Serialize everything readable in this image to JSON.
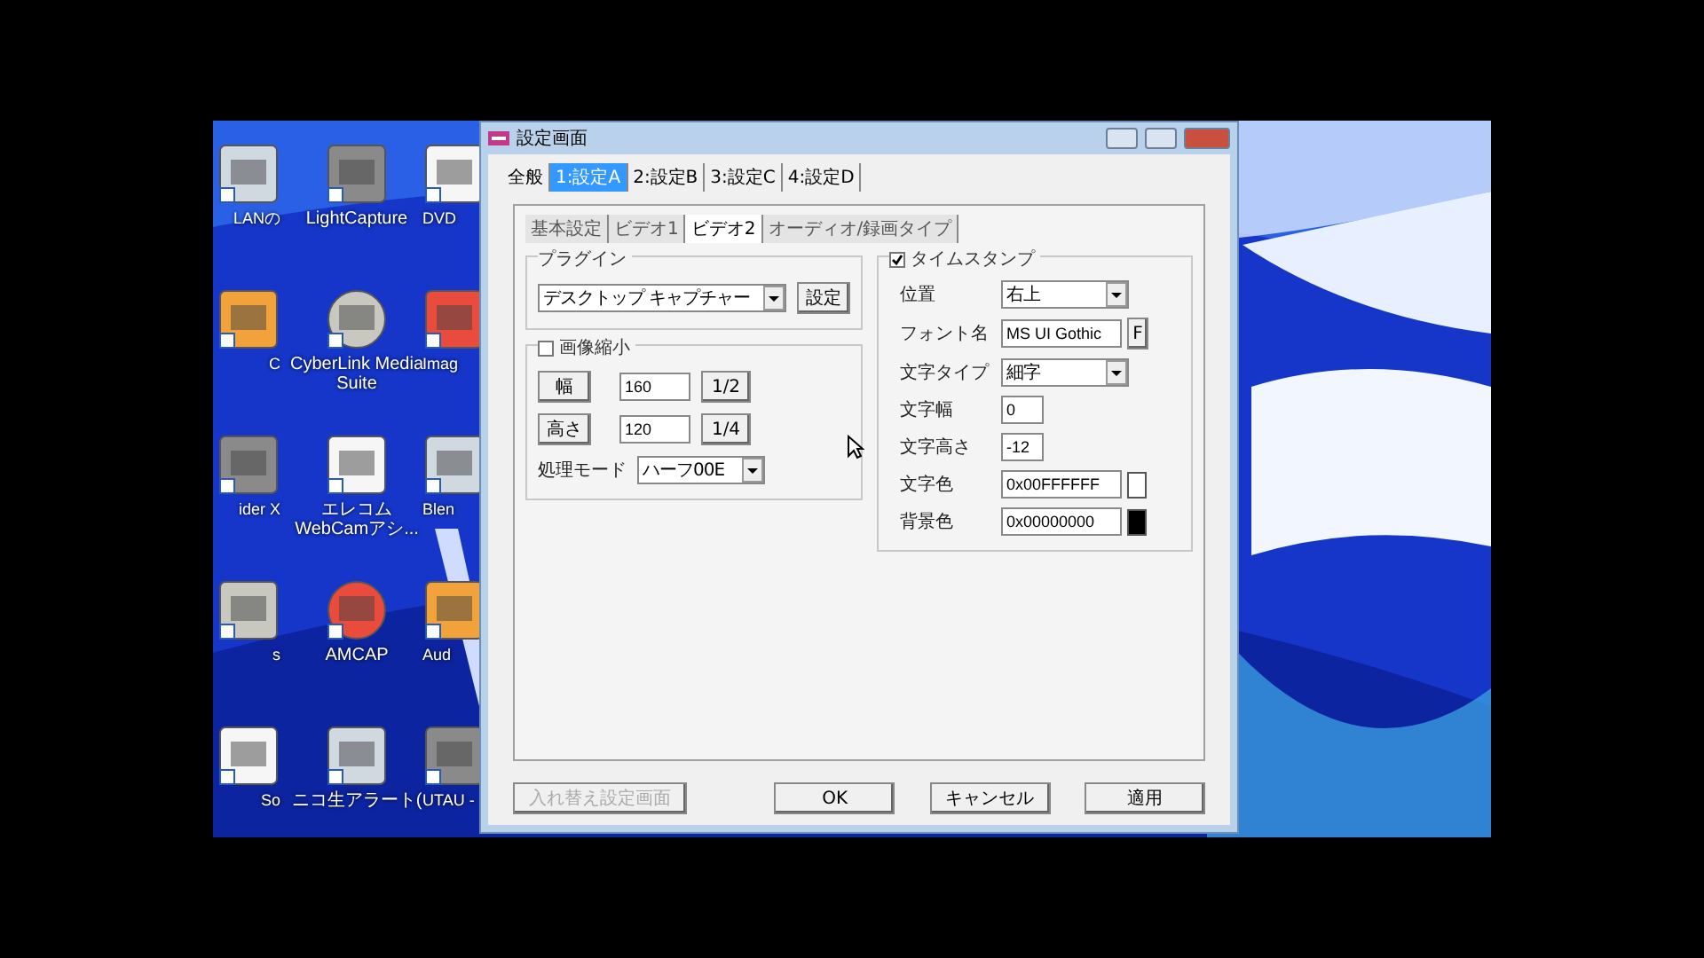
{
  "desktop": {
    "columns": [
      {
        "icons": [
          {
            "label": "LANの"
          },
          {
            "label": "C"
          },
          {
            "label": "ider X"
          },
          {
            "label": "s"
          },
          {
            "label": "So"
          }
        ]
      },
      {
        "icons": [
          {
            "label": "LightCapture"
          },
          {
            "label": "CyberLink Media Suite"
          },
          {
            "label": "エレコム WebCamアシ..."
          },
          {
            "label": "AMCAP"
          },
          {
            "label": "ニコ生アラート("
          }
        ]
      },
      {
        "icons": [
          {
            "label": "DVD"
          },
          {
            "label": "Imag"
          },
          {
            "label": "Blen"
          },
          {
            "label": "Aud"
          },
          {
            "label": "UTAU - "
          }
        ]
      }
    ]
  },
  "dialog": {
    "title": "設定画面",
    "tabs": [
      {
        "label": "全般",
        "selected": false
      },
      {
        "label": "1:設定A",
        "selected": true
      },
      {
        "label": "2:設定B",
        "selected": false
      },
      {
        "label": "3:設定C",
        "selected": false
      },
      {
        "label": "4:設定D",
        "selected": false
      }
    ],
    "subtabs": [
      {
        "label": "基本設定",
        "selected": false
      },
      {
        "label": "ビデオ1",
        "selected": false
      },
      {
        "label": "ビデオ2",
        "selected": true
      },
      {
        "label": "オーディオ/録画タイプ",
        "selected": false
      }
    ],
    "plugin_group": {
      "title": "プラグイン",
      "plugin": "デスクトップ キャプチャー",
      "button": "設定"
    },
    "resize_group": {
      "title": "画像縮小",
      "checked": false,
      "rows": [
        {
          "button": "幅",
          "value": "160",
          "ratio": "1/2"
        },
        {
          "button": "高さ",
          "value": "120",
          "ratio": "1/4"
        }
      ],
      "mode_label": "処理モード",
      "mode": "ハーフ00E"
    },
    "timestamp_group": {
      "title": "タイムスタンプ",
      "checked": true,
      "rows": [
        {
          "kind": "select",
          "label": "位置",
          "value": "右上"
        },
        {
          "kind": "font",
          "label": "フォント名",
          "value": "MS UI Gothic",
          "button": "F"
        },
        {
          "kind": "select",
          "label": "文字タイプ",
          "value": "細字"
        },
        {
          "kind": "text",
          "label": "文字幅",
          "value": "0"
        },
        {
          "kind": "text",
          "label": "文字高さ",
          "value": "-12"
        },
        {
          "kind": "color",
          "label": "文字色",
          "value": "0x00FFFFFF",
          "color": "#ffffff"
        },
        {
          "kind": "color",
          "label": "背景色",
          "value": "0x00000000",
          "color": "#000000"
        }
      ]
    },
    "buttons": [
      {
        "label": "入れ替え設定画面",
        "disabled": true
      },
      {
        "label": "OK",
        "disabled": false
      },
      {
        "label": "キャンセル",
        "disabled": false
      },
      {
        "label": "適用",
        "disabled": false
      }
    ]
  }
}
